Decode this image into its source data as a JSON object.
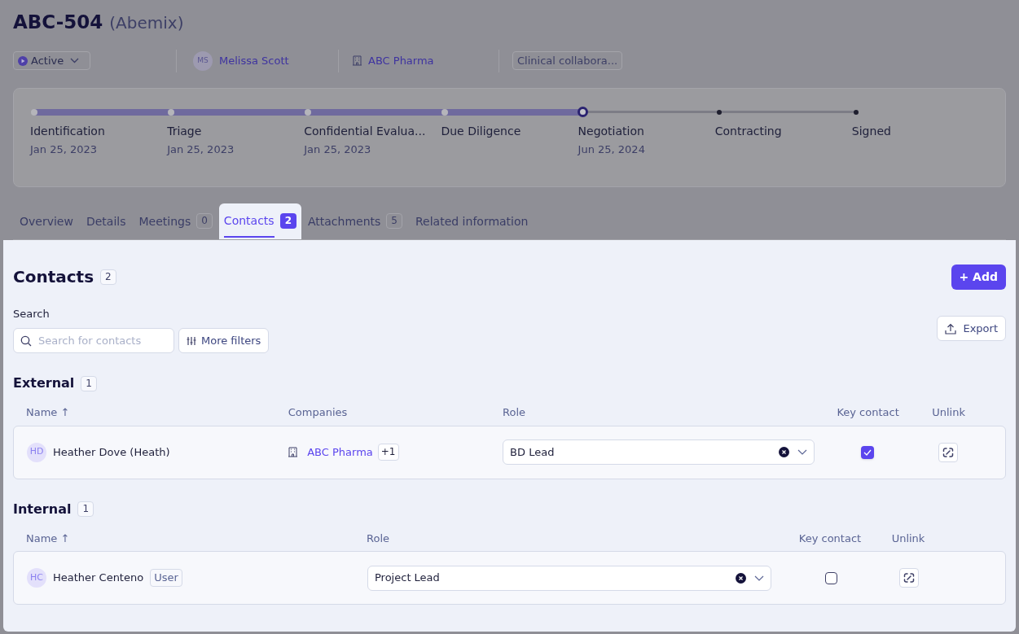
{
  "header": {
    "title": "ABC-504",
    "subtitle": "(Abemix)"
  },
  "meta": {
    "status": "Active",
    "owner_initials": "MS",
    "owner": "Melissa Scott",
    "company": "ABC Pharma",
    "tag": "Clinical collabora..."
  },
  "stages": [
    {
      "label": "Identification",
      "date": "Jan 25, 2023",
      "completed": true,
      "current": false
    },
    {
      "label": "Triage",
      "date": "Jan 25, 2023",
      "completed": true,
      "current": false
    },
    {
      "label": "Confidential Evalua...",
      "date": "Jan 25, 2023",
      "completed": true,
      "current": false
    },
    {
      "label": "Due Diligence",
      "completed": true,
      "current": false
    },
    {
      "label": "Negotiation",
      "date": "Jun 25, 2024",
      "completed": false,
      "current": true
    },
    {
      "label": "Contracting",
      "completed": false,
      "current": false
    },
    {
      "label": "Signed",
      "completed": false,
      "current": false
    }
  ],
  "tabs": [
    {
      "label": "Overview",
      "selected": false
    },
    {
      "label": "Details",
      "selected": false
    },
    {
      "label": "Meetings",
      "count": "0",
      "selected": false
    },
    {
      "label": "Contacts",
      "count": "2",
      "selected": true
    },
    {
      "label": "Attachments",
      "count": "5",
      "selected": false
    },
    {
      "label": "Related information",
      "selected": false
    }
  ],
  "contacts": {
    "title": "Contacts",
    "count": "2",
    "add_button": "+ Add",
    "search_label": "Search",
    "search_placeholder": "Search for contacts",
    "filters_button": "More filters",
    "export_button": "Export",
    "sections": [
      {
        "kind": "external",
        "title": "External",
        "count": "1",
        "columns": [
          "Name ↑",
          "Companies",
          "Role",
          "Key contact",
          "Unlink"
        ],
        "rows": [
          {
            "initials": "HD",
            "name": "Heather Dove (Heath)",
            "company": "ABC Pharma",
            "company_extra": "+1",
            "role": "BD Lead",
            "key_contact": true
          }
        ]
      },
      {
        "kind": "internal",
        "title": "Internal",
        "count": "1",
        "columns": [
          "Name ↑",
          "Role",
          "Key contact",
          "Unlink"
        ],
        "rows": [
          {
            "initials": "HC",
            "name": "Heather Centeno",
            "badge": "User",
            "role": "Project Lead",
            "key_contact": false
          }
        ]
      }
    ]
  }
}
